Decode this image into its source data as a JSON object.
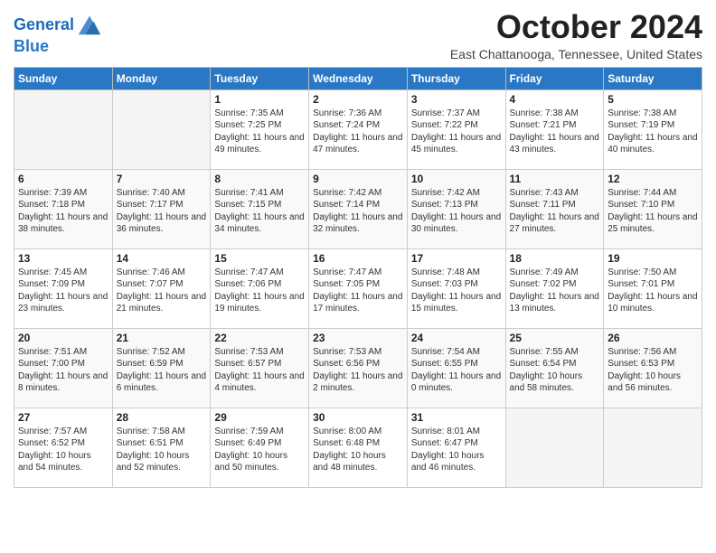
{
  "logo": {
    "line1": "General",
    "line2": "Blue"
  },
  "title": "October 2024",
  "location": "East Chattanooga, Tennessee, United States",
  "days_of_week": [
    "Sunday",
    "Monday",
    "Tuesday",
    "Wednesday",
    "Thursday",
    "Friday",
    "Saturday"
  ],
  "weeks": [
    [
      {
        "day": "",
        "empty": true
      },
      {
        "day": "",
        "empty": true
      },
      {
        "day": "1",
        "sunrise": "Sunrise: 7:35 AM",
        "sunset": "Sunset: 7:25 PM",
        "daylight": "Daylight: 11 hours and 49 minutes."
      },
      {
        "day": "2",
        "sunrise": "Sunrise: 7:36 AM",
        "sunset": "Sunset: 7:24 PM",
        "daylight": "Daylight: 11 hours and 47 minutes."
      },
      {
        "day": "3",
        "sunrise": "Sunrise: 7:37 AM",
        "sunset": "Sunset: 7:22 PM",
        "daylight": "Daylight: 11 hours and 45 minutes."
      },
      {
        "day": "4",
        "sunrise": "Sunrise: 7:38 AM",
        "sunset": "Sunset: 7:21 PM",
        "daylight": "Daylight: 11 hours and 43 minutes."
      },
      {
        "day": "5",
        "sunrise": "Sunrise: 7:38 AM",
        "sunset": "Sunset: 7:19 PM",
        "daylight": "Daylight: 11 hours and 40 minutes."
      }
    ],
    [
      {
        "day": "6",
        "sunrise": "Sunrise: 7:39 AM",
        "sunset": "Sunset: 7:18 PM",
        "daylight": "Daylight: 11 hours and 38 minutes."
      },
      {
        "day": "7",
        "sunrise": "Sunrise: 7:40 AM",
        "sunset": "Sunset: 7:17 PM",
        "daylight": "Daylight: 11 hours and 36 minutes."
      },
      {
        "day": "8",
        "sunrise": "Sunrise: 7:41 AM",
        "sunset": "Sunset: 7:15 PM",
        "daylight": "Daylight: 11 hours and 34 minutes."
      },
      {
        "day": "9",
        "sunrise": "Sunrise: 7:42 AM",
        "sunset": "Sunset: 7:14 PM",
        "daylight": "Daylight: 11 hours and 32 minutes."
      },
      {
        "day": "10",
        "sunrise": "Sunrise: 7:42 AM",
        "sunset": "Sunset: 7:13 PM",
        "daylight": "Daylight: 11 hours and 30 minutes."
      },
      {
        "day": "11",
        "sunrise": "Sunrise: 7:43 AM",
        "sunset": "Sunset: 7:11 PM",
        "daylight": "Daylight: 11 hours and 27 minutes."
      },
      {
        "day": "12",
        "sunrise": "Sunrise: 7:44 AM",
        "sunset": "Sunset: 7:10 PM",
        "daylight": "Daylight: 11 hours and 25 minutes."
      }
    ],
    [
      {
        "day": "13",
        "sunrise": "Sunrise: 7:45 AM",
        "sunset": "Sunset: 7:09 PM",
        "daylight": "Daylight: 11 hours and 23 minutes."
      },
      {
        "day": "14",
        "sunrise": "Sunrise: 7:46 AM",
        "sunset": "Sunset: 7:07 PM",
        "daylight": "Daylight: 11 hours and 21 minutes."
      },
      {
        "day": "15",
        "sunrise": "Sunrise: 7:47 AM",
        "sunset": "Sunset: 7:06 PM",
        "daylight": "Daylight: 11 hours and 19 minutes."
      },
      {
        "day": "16",
        "sunrise": "Sunrise: 7:47 AM",
        "sunset": "Sunset: 7:05 PM",
        "daylight": "Daylight: 11 hours and 17 minutes."
      },
      {
        "day": "17",
        "sunrise": "Sunrise: 7:48 AM",
        "sunset": "Sunset: 7:03 PM",
        "daylight": "Daylight: 11 hours and 15 minutes."
      },
      {
        "day": "18",
        "sunrise": "Sunrise: 7:49 AM",
        "sunset": "Sunset: 7:02 PM",
        "daylight": "Daylight: 11 hours and 13 minutes."
      },
      {
        "day": "19",
        "sunrise": "Sunrise: 7:50 AM",
        "sunset": "Sunset: 7:01 PM",
        "daylight": "Daylight: 11 hours and 10 minutes."
      }
    ],
    [
      {
        "day": "20",
        "sunrise": "Sunrise: 7:51 AM",
        "sunset": "Sunset: 7:00 PM",
        "daylight": "Daylight: 11 hours and 8 minutes."
      },
      {
        "day": "21",
        "sunrise": "Sunrise: 7:52 AM",
        "sunset": "Sunset: 6:59 PM",
        "daylight": "Daylight: 11 hours and 6 minutes."
      },
      {
        "day": "22",
        "sunrise": "Sunrise: 7:53 AM",
        "sunset": "Sunset: 6:57 PM",
        "daylight": "Daylight: 11 hours and 4 minutes."
      },
      {
        "day": "23",
        "sunrise": "Sunrise: 7:53 AM",
        "sunset": "Sunset: 6:56 PM",
        "daylight": "Daylight: 11 hours and 2 minutes."
      },
      {
        "day": "24",
        "sunrise": "Sunrise: 7:54 AM",
        "sunset": "Sunset: 6:55 PM",
        "daylight": "Daylight: 11 hours and 0 minutes."
      },
      {
        "day": "25",
        "sunrise": "Sunrise: 7:55 AM",
        "sunset": "Sunset: 6:54 PM",
        "daylight": "Daylight: 10 hours and 58 minutes."
      },
      {
        "day": "26",
        "sunrise": "Sunrise: 7:56 AM",
        "sunset": "Sunset: 6:53 PM",
        "daylight": "Daylight: 10 hours and 56 minutes."
      }
    ],
    [
      {
        "day": "27",
        "sunrise": "Sunrise: 7:57 AM",
        "sunset": "Sunset: 6:52 PM",
        "daylight": "Daylight: 10 hours and 54 minutes."
      },
      {
        "day": "28",
        "sunrise": "Sunrise: 7:58 AM",
        "sunset": "Sunset: 6:51 PM",
        "daylight": "Daylight: 10 hours and 52 minutes."
      },
      {
        "day": "29",
        "sunrise": "Sunrise: 7:59 AM",
        "sunset": "Sunset: 6:49 PM",
        "daylight": "Daylight: 10 hours and 50 minutes."
      },
      {
        "day": "30",
        "sunrise": "Sunrise: 8:00 AM",
        "sunset": "Sunset: 6:48 PM",
        "daylight": "Daylight: 10 hours and 48 minutes."
      },
      {
        "day": "31",
        "sunrise": "Sunrise: 8:01 AM",
        "sunset": "Sunset: 6:47 PM",
        "daylight": "Daylight: 10 hours and 46 minutes."
      },
      {
        "day": "",
        "empty": true
      },
      {
        "day": "",
        "empty": true
      }
    ]
  ]
}
